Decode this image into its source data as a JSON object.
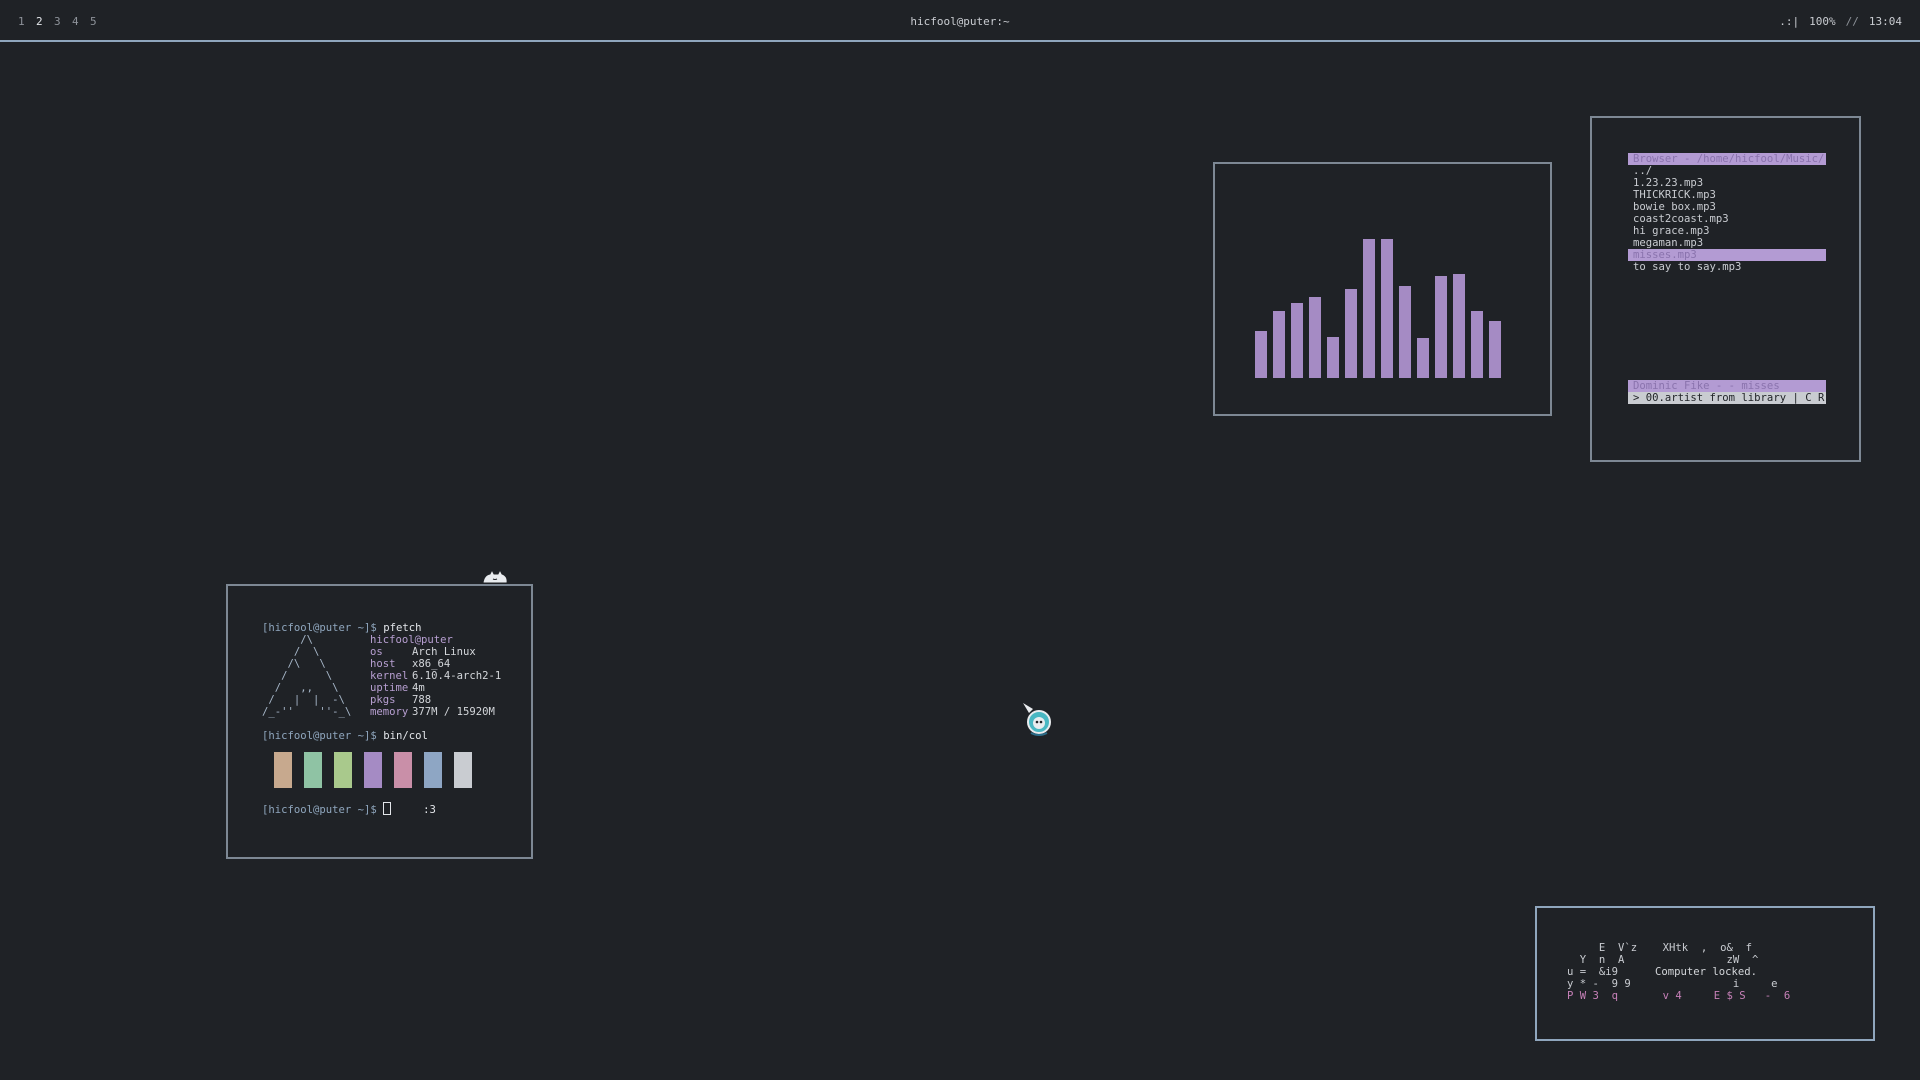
{
  "topbar": {
    "workspaces": [
      "1",
      "2",
      "3",
      "4",
      "5"
    ],
    "active_workspace": "2",
    "title": "hicfool@puter:~",
    "status_signal": ".:|",
    "status_volume": "100%",
    "status_sep": "//",
    "status_time": "13:04"
  },
  "terminal": {
    "prompt1": "[hicfool@puter ~]$",
    "cmd1": "pfetch",
    "logo": [
      "      /\\",
      "     /  \\",
      "    /\\   \\",
      "   /      \\",
      "  /   ,,   \\",
      " /   |  |  -\\",
      "/_-''    ''-_\\"
    ],
    "user": "hicfool@puter",
    "info": [
      {
        "k": "os",
        "v": "Arch Linux"
      },
      {
        "k": "host",
        "v": "x86_64"
      },
      {
        "k": "kernel",
        "v": "6.10.4-arch2-1"
      },
      {
        "k": "uptime",
        "v": "4m"
      },
      {
        "k": "pkgs",
        "v": "788"
      },
      {
        "k": "memory",
        "v": "377M / 15920M"
      }
    ],
    "prompt2": "[hicfool@puter ~]$",
    "cmd2": "bin/col",
    "swatches": [
      "#c7a98e",
      "#8fc3a4",
      "#a9c98c",
      "#a58bc4",
      "#c98fa8",
      "#8ea6c4",
      "#c9ccd1"
    ],
    "prompt3": "[hicfool@puter ~]$",
    "trailing": ":3"
  },
  "visualizer": {
    "bar_color": "#a58bc4",
    "levels": [
      0.33,
      0.47,
      0.53,
      0.57,
      0.29,
      0.63,
      0.98,
      0.98,
      0.65,
      0.28,
      0.72,
      0.73,
      0.47,
      0.4
    ]
  },
  "music": {
    "header": "Browser - /home/hicfool/Music/",
    "files": [
      "../",
      "1.23.23.mp3",
      "THICKRICK.mp3",
      "bowie box.mp3",
      "coast2coast.mp3",
      "hi grace.mp3",
      "megaman.mp3",
      "misses.mp3",
      "to say to say.mp3"
    ],
    "selected_index": 7,
    "now_playing": "Dominic Fike - - misses",
    "command_line": "> 00.artist from library | C R"
  },
  "lock": {
    "message": "Computer locked.",
    "noise_lines": [
      "     E  V`z    XHtk  ,  o&  f",
      "  Y  n  A                zW  ^",
      "u =  &i9  ",
      "y * -  9 9                i     e",
      "P W 3  q       v 4     E $ S   -  6"
    ]
  }
}
